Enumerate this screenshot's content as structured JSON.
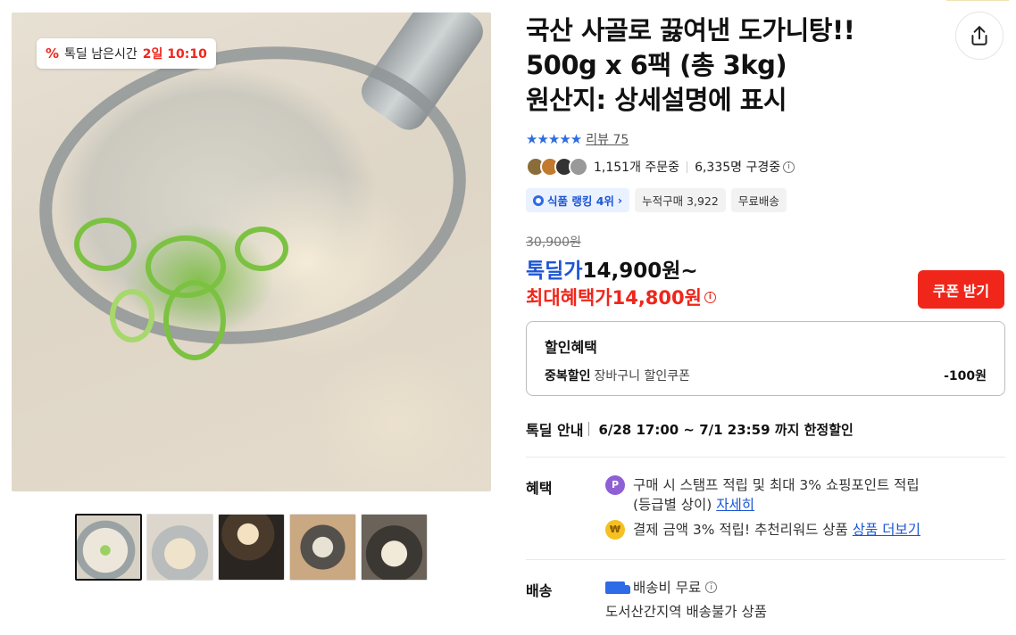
{
  "gallery": {
    "timer_label": "톡딜 남은시간",
    "timer_value": "2일 10:10",
    "thumbnail_count": 5
  },
  "product": {
    "title_lines": [
      "국산 사골로 끓여낸 도가니탕!!",
      "500g x 6팩 (총 3kg)",
      "원산지: 상세설명에 표시"
    ],
    "rating_stars": 4.5,
    "stars_text": "★★★★★",
    "review_text": "리뷰 75",
    "order_count": "1,151개 주문중",
    "watching": "6,335명 구경중",
    "chips": {
      "ranking": "식품 랭킹 4위",
      "cumulative": "누적구매 3,922",
      "shipping": "무료배송"
    }
  },
  "price": {
    "original": "30,900원",
    "deal_label": "톡딜가",
    "deal_value": "14,900원~",
    "max_label": "최대혜택가",
    "max_value": "14,800원",
    "coupon_button": "쿠폰 받기"
  },
  "discount": {
    "title": "할인혜택",
    "row_key": "중복할인",
    "row_desc": "장바구니 할인쿠폰",
    "row_value": "-100원"
  },
  "deal_info": {
    "label": "톡딜 안내",
    "text": "6/28 17:00 ~ 7/1 23:59 까지 한정할인"
  },
  "benefits": {
    "label": "혜택",
    "line1_text": "구매 시 스탬프 적립 및 최대 3% 쇼핑포인트 적립",
    "line1_sub": "(등급별 상이)",
    "line1_link": "자세히",
    "line2_text": "결제 금액 3% 적립! 추천리워드 상품",
    "line2_link": "상품 더보기",
    "coin_p": "P"
  },
  "shipping": {
    "label": "배송",
    "fee": "배송비 무료",
    "note": "도서산간지역 배송불가 상품"
  },
  "colors": {
    "accent_red": "#f0261b",
    "accent_blue": "#1c55d4"
  }
}
